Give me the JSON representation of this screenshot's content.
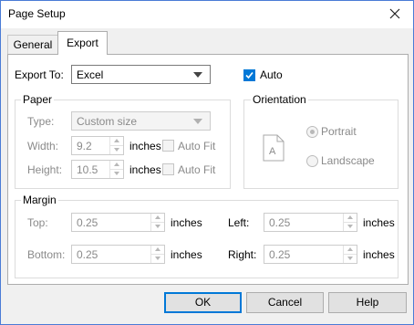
{
  "window": {
    "title": "Page Setup"
  },
  "tabs": [
    {
      "label": "General"
    },
    {
      "label": "Export"
    }
  ],
  "export": {
    "label": "Export To:",
    "value": "Excel",
    "auto_label": "Auto",
    "auto_checked": true
  },
  "paper": {
    "group_label": "Paper",
    "type_label": "Type:",
    "type_value": "Custom size",
    "width_label": "Width:",
    "width_value": "9.2",
    "height_label": "Height:",
    "height_value": "10.5",
    "unit": "inches",
    "autofit_label": "Auto Fit"
  },
  "orientation": {
    "group_label": "Orientation",
    "icon_letter": "A",
    "portrait_label": "Portrait",
    "landscape_label": "Landscape",
    "selected": "Portrait"
  },
  "margin": {
    "group_label": "Margin",
    "top_label": "Top:",
    "top_value": "0.25",
    "bottom_label": "Bottom:",
    "bottom_value": "0.25",
    "left_label": "Left:",
    "left_value": "0.25",
    "right_label": "Right:",
    "right_value": "0.25",
    "unit": "inches"
  },
  "buttons": {
    "ok": "OK",
    "cancel": "Cancel",
    "help": "Help"
  }
}
